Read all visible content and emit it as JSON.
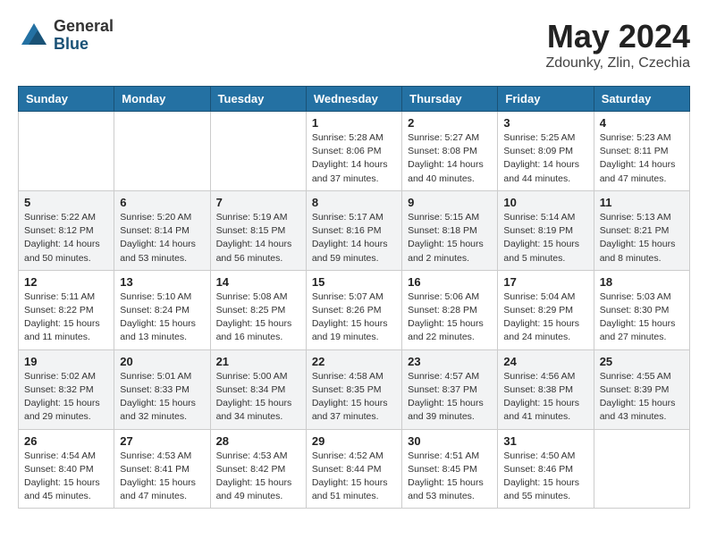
{
  "logo": {
    "general": "General",
    "blue": "Blue"
  },
  "title": "May 2024",
  "location": "Zdounky, Zlin, Czechia",
  "days_header": [
    "Sunday",
    "Monday",
    "Tuesday",
    "Wednesday",
    "Thursday",
    "Friday",
    "Saturday"
  ],
  "weeks": [
    [
      {
        "day": "",
        "info": ""
      },
      {
        "day": "",
        "info": ""
      },
      {
        "day": "",
        "info": ""
      },
      {
        "day": "1",
        "info": "Sunrise: 5:28 AM\nSunset: 8:06 PM\nDaylight: 14 hours\nand 37 minutes."
      },
      {
        "day": "2",
        "info": "Sunrise: 5:27 AM\nSunset: 8:08 PM\nDaylight: 14 hours\nand 40 minutes."
      },
      {
        "day": "3",
        "info": "Sunrise: 5:25 AM\nSunset: 8:09 PM\nDaylight: 14 hours\nand 44 minutes."
      },
      {
        "day": "4",
        "info": "Sunrise: 5:23 AM\nSunset: 8:11 PM\nDaylight: 14 hours\nand 47 minutes."
      }
    ],
    [
      {
        "day": "5",
        "info": "Sunrise: 5:22 AM\nSunset: 8:12 PM\nDaylight: 14 hours\nand 50 minutes."
      },
      {
        "day": "6",
        "info": "Sunrise: 5:20 AM\nSunset: 8:14 PM\nDaylight: 14 hours\nand 53 minutes."
      },
      {
        "day": "7",
        "info": "Sunrise: 5:19 AM\nSunset: 8:15 PM\nDaylight: 14 hours\nand 56 minutes."
      },
      {
        "day": "8",
        "info": "Sunrise: 5:17 AM\nSunset: 8:16 PM\nDaylight: 14 hours\nand 59 minutes."
      },
      {
        "day": "9",
        "info": "Sunrise: 5:15 AM\nSunset: 8:18 PM\nDaylight: 15 hours\nand 2 minutes."
      },
      {
        "day": "10",
        "info": "Sunrise: 5:14 AM\nSunset: 8:19 PM\nDaylight: 15 hours\nand 5 minutes."
      },
      {
        "day": "11",
        "info": "Sunrise: 5:13 AM\nSunset: 8:21 PM\nDaylight: 15 hours\nand 8 minutes."
      }
    ],
    [
      {
        "day": "12",
        "info": "Sunrise: 5:11 AM\nSunset: 8:22 PM\nDaylight: 15 hours\nand 11 minutes."
      },
      {
        "day": "13",
        "info": "Sunrise: 5:10 AM\nSunset: 8:24 PM\nDaylight: 15 hours\nand 13 minutes."
      },
      {
        "day": "14",
        "info": "Sunrise: 5:08 AM\nSunset: 8:25 PM\nDaylight: 15 hours\nand 16 minutes."
      },
      {
        "day": "15",
        "info": "Sunrise: 5:07 AM\nSunset: 8:26 PM\nDaylight: 15 hours\nand 19 minutes."
      },
      {
        "day": "16",
        "info": "Sunrise: 5:06 AM\nSunset: 8:28 PM\nDaylight: 15 hours\nand 22 minutes."
      },
      {
        "day": "17",
        "info": "Sunrise: 5:04 AM\nSunset: 8:29 PM\nDaylight: 15 hours\nand 24 minutes."
      },
      {
        "day": "18",
        "info": "Sunrise: 5:03 AM\nSunset: 8:30 PM\nDaylight: 15 hours\nand 27 minutes."
      }
    ],
    [
      {
        "day": "19",
        "info": "Sunrise: 5:02 AM\nSunset: 8:32 PM\nDaylight: 15 hours\nand 29 minutes."
      },
      {
        "day": "20",
        "info": "Sunrise: 5:01 AM\nSunset: 8:33 PM\nDaylight: 15 hours\nand 32 minutes."
      },
      {
        "day": "21",
        "info": "Sunrise: 5:00 AM\nSunset: 8:34 PM\nDaylight: 15 hours\nand 34 minutes."
      },
      {
        "day": "22",
        "info": "Sunrise: 4:58 AM\nSunset: 8:35 PM\nDaylight: 15 hours\nand 37 minutes."
      },
      {
        "day": "23",
        "info": "Sunrise: 4:57 AM\nSunset: 8:37 PM\nDaylight: 15 hours\nand 39 minutes."
      },
      {
        "day": "24",
        "info": "Sunrise: 4:56 AM\nSunset: 8:38 PM\nDaylight: 15 hours\nand 41 minutes."
      },
      {
        "day": "25",
        "info": "Sunrise: 4:55 AM\nSunset: 8:39 PM\nDaylight: 15 hours\nand 43 minutes."
      }
    ],
    [
      {
        "day": "26",
        "info": "Sunrise: 4:54 AM\nSunset: 8:40 PM\nDaylight: 15 hours\nand 45 minutes."
      },
      {
        "day": "27",
        "info": "Sunrise: 4:53 AM\nSunset: 8:41 PM\nDaylight: 15 hours\nand 47 minutes."
      },
      {
        "day": "28",
        "info": "Sunrise: 4:53 AM\nSunset: 8:42 PM\nDaylight: 15 hours\nand 49 minutes."
      },
      {
        "day": "29",
        "info": "Sunrise: 4:52 AM\nSunset: 8:44 PM\nDaylight: 15 hours\nand 51 minutes."
      },
      {
        "day": "30",
        "info": "Sunrise: 4:51 AM\nSunset: 8:45 PM\nDaylight: 15 hours\nand 53 minutes."
      },
      {
        "day": "31",
        "info": "Sunrise: 4:50 AM\nSunset: 8:46 PM\nDaylight: 15 hours\nand 55 minutes."
      },
      {
        "day": "",
        "info": ""
      }
    ]
  ]
}
